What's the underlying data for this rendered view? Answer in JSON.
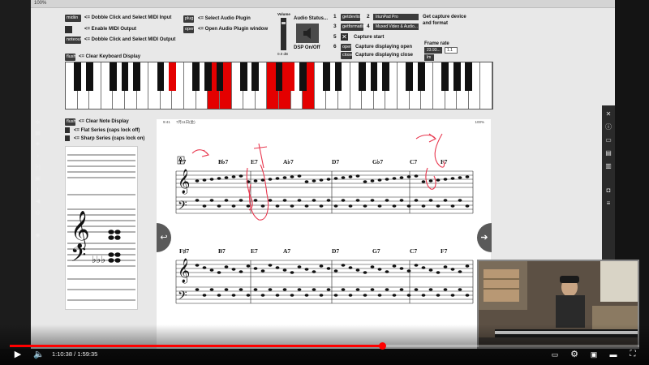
{
  "patch": {
    "zoom": "100%",
    "midi": {
      "midiin_label": "midiin",
      "midiin_text": "<= Dobble Click and Select MIDI Input",
      "enable_text": "<= Enable MIDI Output",
      "noteout_label": "noteout",
      "noteout_text": "<= Dobble Click and Select MIDI Output"
    },
    "audio": {
      "plug_label": "plug",
      "plug_text": "<= Select Audio Plugin",
      "open_label": "open",
      "open_text": "<= Open Audio Plugin window",
      "volume_label": "Volume",
      "db_value": "0.0 dB",
      "status_label": "Audio Status...",
      "dsp_label": "DSP On/Off"
    },
    "capture": {
      "row1_num": "1",
      "getdevlist": "getdevlist",
      "row2_num": "2",
      "device": "IriunPad Pro",
      "row3_num": "3",
      "getformatlist": "getformatlist",
      "row4_num": "4",
      "format": "Muxed Video & Audio...",
      "get_text": "Get capture device and format",
      "row5_num": "5",
      "start_text": "Capture start",
      "row6_num": "6",
      "open_label": "open",
      "open_text": "Capture displaying open",
      "close_label": "close",
      "close_text": "Capture displaying close",
      "framerate_label": "Frame rate",
      "framerate_value": "23.93...",
      "framerate_out": "1.1",
      "framerate_menu": "lm"
    },
    "keyboard": {
      "flush_label": "flush",
      "clear_text": "<= Clear Keyboard Display",
      "white_count": 36,
      "pressed_white": [
        12,
        13,
        17,
        18,
        20
      ],
      "pressed_black": [
        6,
        13
      ]
    },
    "note_display": {
      "flush_label": "flush",
      "clear_text": "<= Clear Note Display",
      "flat_text": "<= Flat Series (caps lock off)",
      "sharp_text": "<= Sharp Series (caps lock on)"
    }
  },
  "sheet": {
    "status_time": "9:41",
    "status_date": "7月11日(金)",
    "status_battery": "100%",
    "rehearsal_mark": "A",
    "system1_chords": [
      "F7",
      "B♭7",
      "E7",
      "A♭7",
      "D7",
      "G♭7",
      "C7",
      "F7"
    ],
    "system2_chords": [
      "F♯7",
      "B7",
      "E7",
      "A7",
      "D7",
      "G7",
      "C7",
      "F7"
    ]
  },
  "player": {
    "current_time": "1:10:38",
    "separator": "/",
    "duration": "1:59:35",
    "progress_fraction": 0.591,
    "buffer_fraction": 0.62
  },
  "colors": {
    "pressed_key": "#e40000",
    "progress": "#ff0000",
    "annotation": "#e8384f"
  }
}
